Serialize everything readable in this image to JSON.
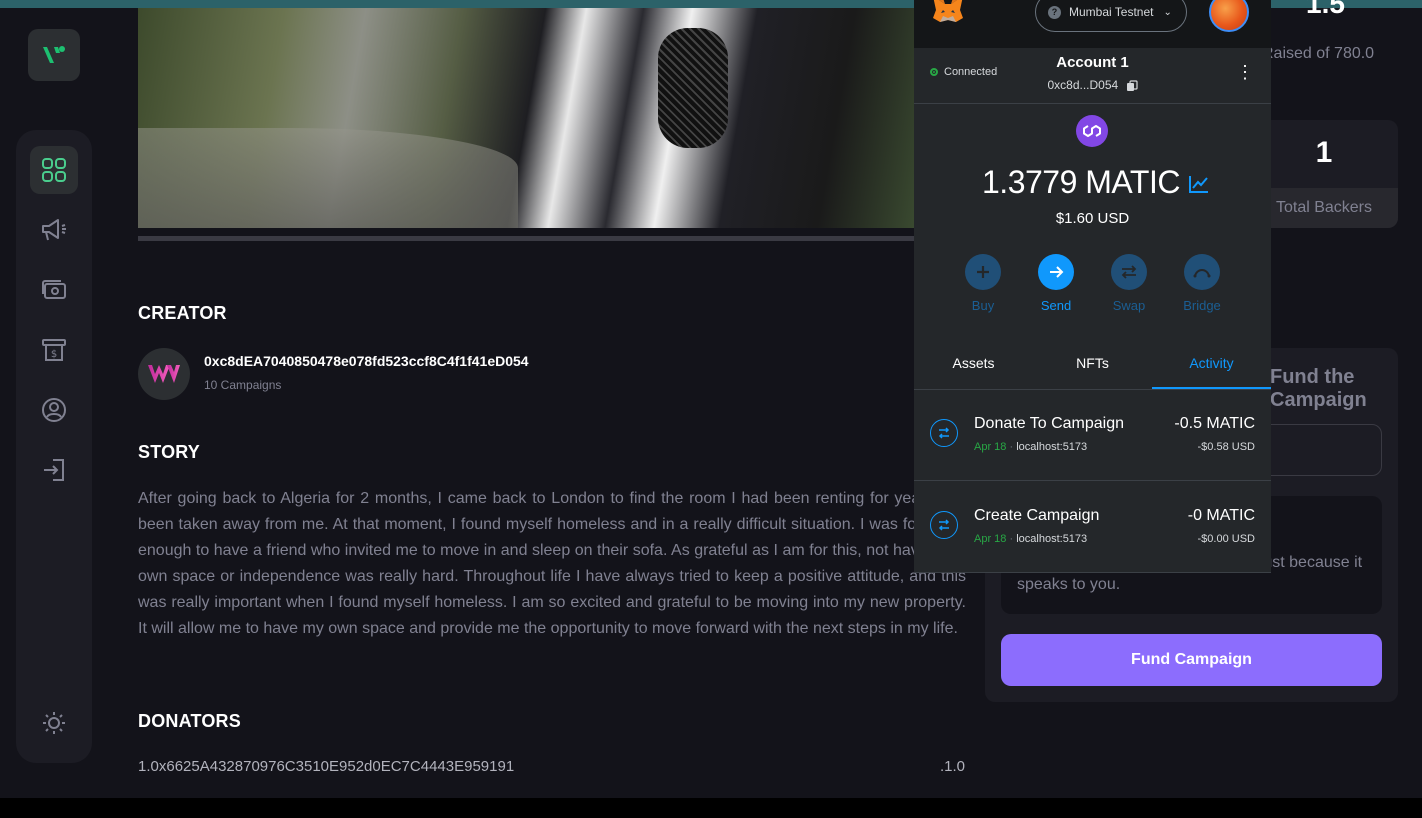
{
  "app": {
    "colors": {
      "accent": "#8c6dfd",
      "green": "#4acd8d",
      "metamask_blue": "#1098fc"
    }
  },
  "sidebar": {
    "items": [
      {
        "icon": "dashboard-icon",
        "active": true
      },
      {
        "icon": "campaign-icon",
        "active": false
      },
      {
        "icon": "payment-icon",
        "active": false
      },
      {
        "icon": "withdraw-icon",
        "active": false
      },
      {
        "icon": "profile-icon",
        "active": false
      },
      {
        "icon": "logout-icon",
        "active": false
      }
    ],
    "theme_icon": "sun-icon"
  },
  "main": {
    "creator_title": "Creator",
    "creator_address": "0xc8dEA7040850478e078fd523ccf8C4f1f41eD054",
    "creator_campaigns": "10 Campaigns",
    "story_title": "Story",
    "story_text": "After going back to Algeria for 2 months, I came back to London to find the room I had been renting for years had been taken away from me. At that moment, I found myself homeless and in a really difficult situation. I was fortunate enough to have a friend who invited me to move in and sleep on their sofa. As grateful as I am for this, not having my own space or independence was really hard. Throughout life I have always tried to keep a positive attitude, and this was really important when I found myself homeless. I am so excited and grateful to be moving into my new property. It will allow me to have my own space and provide me the opportunity to move forward with the next steps in my life.",
    "donators_title": "Donators",
    "donators": [
      {
        "entry": "1.0x6625A432870976C3510E952d0EC7C4443E959191",
        "amount": ".1.0"
      }
    ]
  },
  "stats": {
    "raised_value": "1.5",
    "raised_label": "Raised of 780.0",
    "backers_value": "1",
    "backers_label": "Total Backers"
  },
  "fund": {
    "heading": "Fund the Campaign",
    "info_text": "Support the project for no reward, just because it speaks to you.",
    "button_label": "Fund Campaign"
  },
  "metamask": {
    "network": "Mumbai Testnet",
    "connected_label": "Connected",
    "account_name": "Account 1",
    "account_address": "0xc8d...D054",
    "balance": "1.3779 MATIC",
    "balance_usd": "$1.60 USD",
    "actions": [
      "Buy",
      "Send",
      "Swap",
      "Bridge"
    ],
    "tabs": [
      "Assets",
      "NFTs",
      "Activity"
    ],
    "active_tab": "Activity",
    "transactions": [
      {
        "title": "Donate To Campaign",
        "date": "Apr 18",
        "origin": "localhost:5173",
        "amount": "-0.5 MATIC",
        "usd": "-$0.58 USD"
      },
      {
        "title": "Create Campaign",
        "date": "Apr 18",
        "origin": "localhost:5173",
        "amount": "-0 MATIC",
        "usd": "-$0.00 USD"
      }
    ]
  }
}
